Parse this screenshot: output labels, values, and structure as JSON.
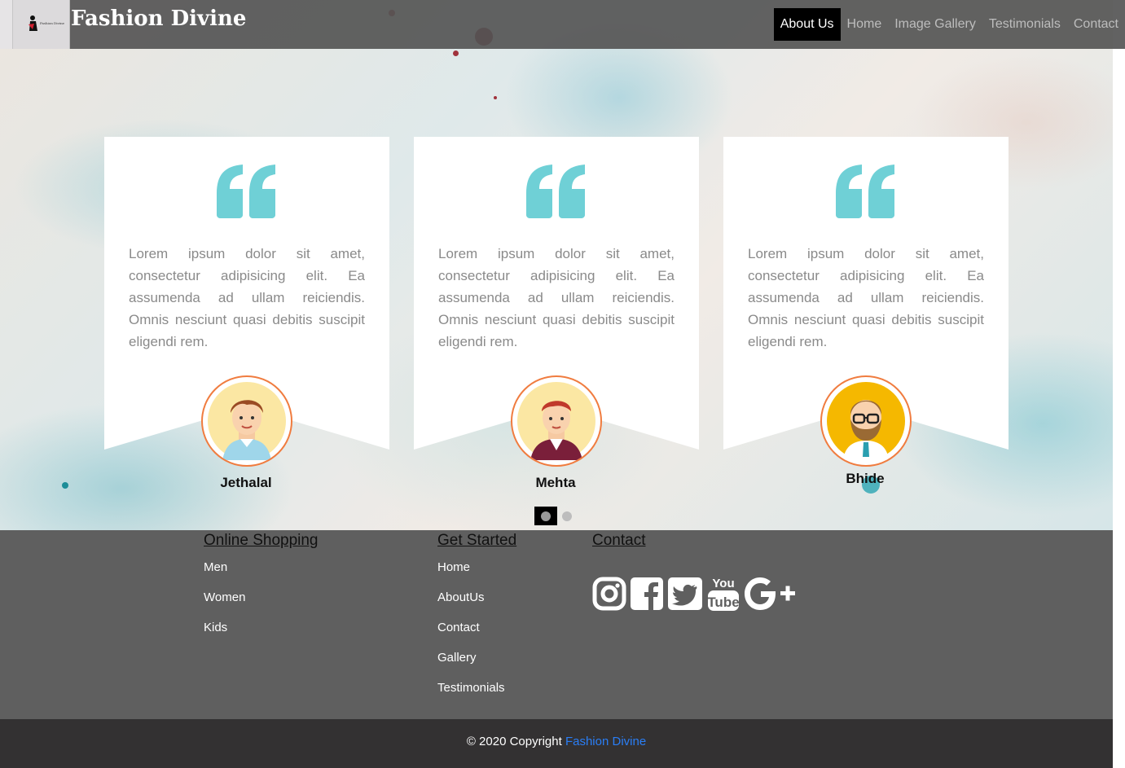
{
  "header": {
    "logo_text": "Fashion Divine",
    "title": "Fashion Divine",
    "nav": [
      {
        "label": "About Us",
        "active": true
      },
      {
        "label": "Home"
      },
      {
        "label": "Image Gallery"
      },
      {
        "label": "Testimonials"
      },
      {
        "label": "Contact"
      }
    ]
  },
  "testimonials": [
    {
      "text": "Lorem ipsum dolor sit amet, consectetur adipisicing elit. Ea assumenda ad ullam reiciendis. Omnis nesciunt quasi debitis suscipit eligendi rem.",
      "name": "Jethalal",
      "icon": "quote-icon"
    },
    {
      "text": "Lorem ipsum dolor sit amet, consectetur adipisicing elit. Ea assumenda ad ullam reiciendis. Omnis nesciunt quasi debitis suscipit eligendi rem.",
      "name": "Mehta",
      "icon": "quote-icon"
    },
    {
      "text": "Lorem ipsum dolor sit amet, consectetur adipisicing elit. Ea assumenda ad ullam reiciendis. Omnis nesciunt quasi debitis suscipit eligendi rem.",
      "name": "Bhide",
      "icon": "quote-icon"
    }
  ],
  "carousel": {
    "active_index": 0,
    "count": 2
  },
  "colors": {
    "accent": "#6fd0d6",
    "avatar_border": "#f07c3f",
    "nav_active": "#000000",
    "footer_bg": "#5f5f5f",
    "copyright_bg": "#333132",
    "link": "#2a7ef6"
  },
  "footer": {
    "columns": [
      {
        "heading": "Online Shopping",
        "links": [
          "Men",
          "Women",
          "Kids"
        ]
      },
      {
        "heading": "Get Started",
        "links": [
          "Home",
          "AboutUs",
          "Contact",
          "Gallery",
          "Testimonials"
        ]
      },
      {
        "heading": "Contact",
        "links": []
      }
    ],
    "socials": [
      "instagram-icon",
      "facebook-icon",
      "twitter-icon",
      "youtube-icon",
      "google-plus-icon"
    ],
    "copyright_prefix": "© 2020 Copyright",
    "copyright_link": "Fashion Divine"
  }
}
